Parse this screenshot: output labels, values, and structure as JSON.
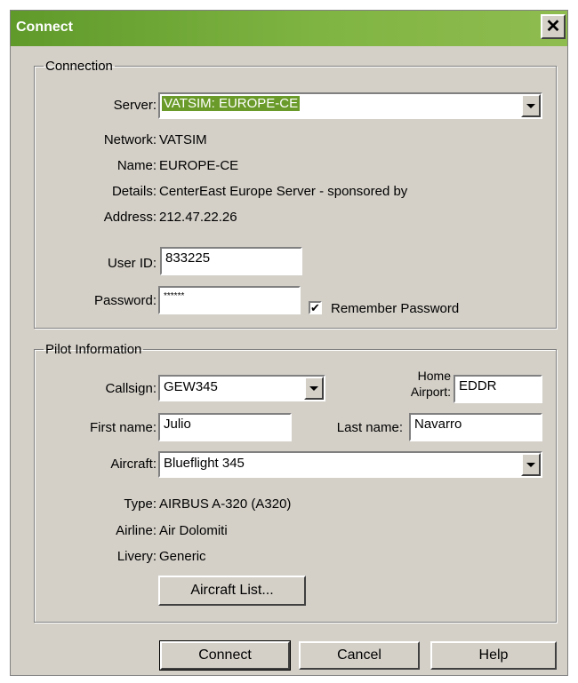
{
  "window": {
    "title": "Connect",
    "close_glyph": "✕"
  },
  "connection": {
    "legend": "Connection",
    "server_label": "Server:",
    "server_value": "VATSIM: EUROPE-CE",
    "network_label": "Network:",
    "network_value": "VATSIM",
    "name_label": "Name:",
    "name_value": "EUROPE-CE",
    "details_label": "Details:",
    "details_value": "CenterEast Europe Server - sponsored by",
    "address_label": "Address:",
    "address_value": "212.47.22.26",
    "userid_label": "User ID:",
    "userid_value": "833225",
    "password_label": "Password:",
    "password_value": "******",
    "remember_label": "Remember Password",
    "remember_checked": true
  },
  "pilot": {
    "legend": "Pilot Information",
    "callsign_label": "Callsign:",
    "callsign_value": "GEW345",
    "home_label_1": "Home",
    "home_label_2": "Airport:",
    "home_value": "EDDR",
    "firstname_label": "First name:",
    "firstname_value": "Julio",
    "lastname_label": "Last name:",
    "lastname_value": "Navarro",
    "aircraft_label": "Aircraft:",
    "aircraft_value": "Blueflight 345",
    "type_label": "Type:",
    "type_value": "AIRBUS A-320 (A320)",
    "airline_label": "Airline:",
    "airline_value": "Air Dolomiti",
    "livery_label": "Livery:",
    "livery_value": "Generic",
    "aircraft_list_button": "Aircraft List..."
  },
  "buttons": {
    "connect": "Connect",
    "cancel": "Cancel",
    "help": "Help"
  },
  "colors": {
    "titlebar": "#6a9b2a",
    "selection": "#6a9b2a",
    "face": "#d4d0c8"
  }
}
